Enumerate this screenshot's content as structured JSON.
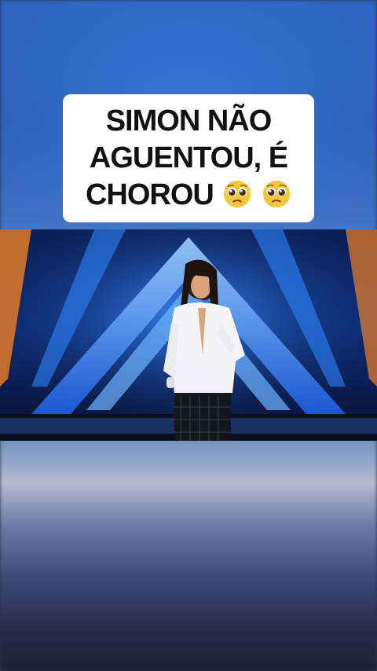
{
  "caption": {
    "line1": "SIMON NÃO",
    "line2": "AGUENTOU, É",
    "line3": "CHOROU",
    "emoji_icon": "pleading-face-emoji"
  },
  "video": {
    "scene": "stage-performance-frame"
  },
  "colors": {
    "caption_bg": "#ffffff",
    "caption_text": "#111111",
    "stage_blue": "#1d5fe0",
    "stage_orange": "#e07a2a"
  }
}
